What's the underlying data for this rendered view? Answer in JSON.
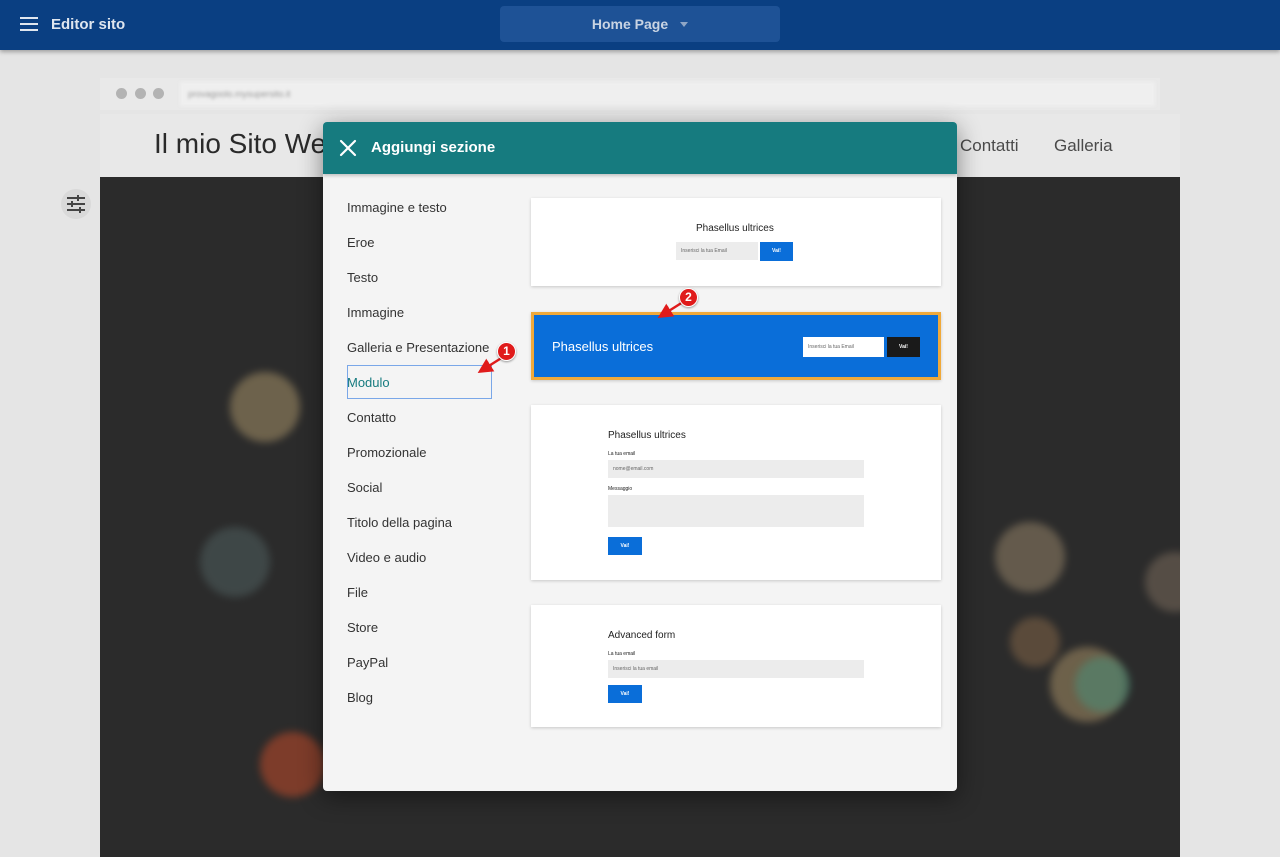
{
  "topbar": {
    "menu_icon": "hamburger-menu-icon",
    "title": "Editor sito",
    "page_selector": "Home Page"
  },
  "preview": {
    "url": "provagoolo.mysupersito.it",
    "site_title": "Il mio Sito Web",
    "nav": [
      "Contatti",
      "Galleria"
    ],
    "settings_icon": "sliders-icon"
  },
  "modal": {
    "title": "Aggiungi sezione",
    "close_icon": "close-icon",
    "categories": [
      "Immagine e testo",
      "Eroe",
      "Testo",
      "Immagine",
      "Galleria e Presentazione",
      "Modulo",
      "Contatto",
      "Promozionale",
      "Social",
      "Titolo della pagina",
      "Video e audio",
      "File",
      "Store",
      "PayPal",
      "Blog"
    ],
    "active_category": "Modulo",
    "templates": {
      "newsletter_centered": {
        "title": "Phasellus ultrices",
        "placeholder": "Inserisci la tua Email",
        "button": "Vai!"
      },
      "newsletter_banner": {
        "title": "Phasellus ultrices",
        "placeholder": "Inserisci la tua Email",
        "button": "Vai!"
      },
      "contact_form": {
        "title": "Phasellus ultrices",
        "email_label": "La tua email",
        "email_placeholder": "nome@email.com",
        "message_label": "Messaggio",
        "button": "Vai!"
      },
      "advanced_form": {
        "title": "Advanced form",
        "email_label": "La tua email",
        "email_placeholder": "Inserisci la tua email",
        "button": "Vai!"
      }
    }
  },
  "annotations": [
    "1",
    "2"
  ],
  "colors": {
    "topbar": "#0a3f82",
    "modal_header": "#167b7f",
    "accent_blue": "#0a6ed9",
    "highlight_border": "#f0a93a",
    "marker_red": "#e01b1b"
  }
}
